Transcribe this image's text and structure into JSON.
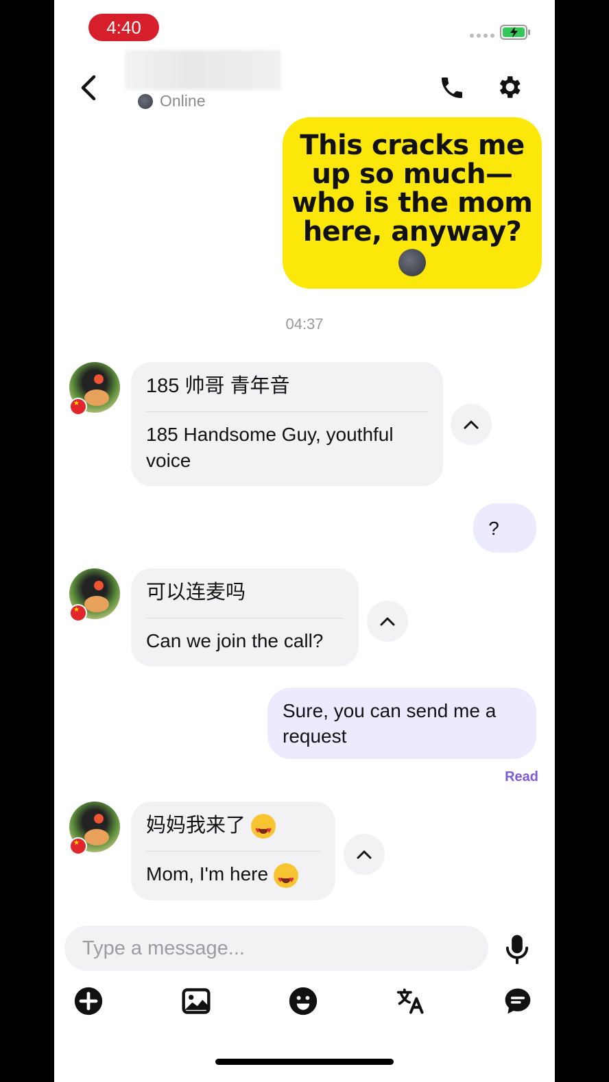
{
  "status_bar": {
    "time": "4:40"
  },
  "header": {
    "presence": "Online"
  },
  "messages": {
    "outgoing_1": "This cracks me up so much—who is the mom here, anyway?",
    "timestamp": "04:37",
    "incoming_1": {
      "original": "185  帅哥  青年音",
      "translation": "185 Handsome Guy, youthful voice"
    },
    "outgoing_2": "?",
    "incoming_2": {
      "original": "可以连麦吗",
      "translation": "Can we join the call?"
    },
    "outgoing_3": "Sure, you can send me a request",
    "read_receipt": "Read",
    "incoming_3": {
      "original": "妈妈我来了",
      "translation": "Mom, I'm here"
    }
  },
  "composer": {
    "placeholder": "Type a message..."
  },
  "toolbar": {
    "icons": [
      "add-icon",
      "image-icon",
      "emoji-icon",
      "translate-icon",
      "chat-icon"
    ]
  },
  "colors": {
    "accent": "#7a5ad9",
    "yellow_bubble": "#fbe70a",
    "outgoing_bubble": "#eceafe",
    "incoming_bubble": "#f2f2f4",
    "time_pill": "#d61f2b"
  }
}
